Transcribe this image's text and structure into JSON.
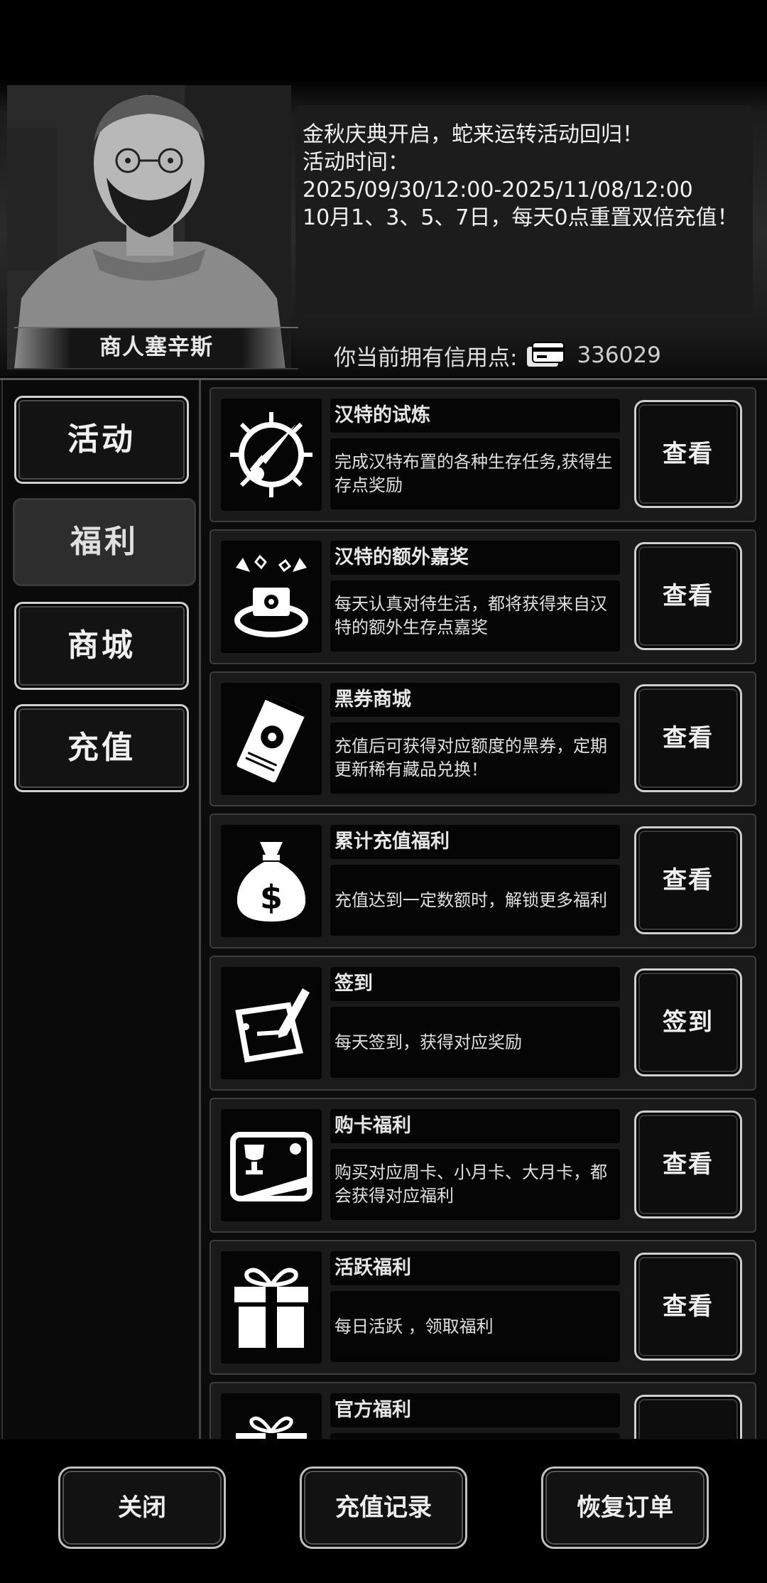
{
  "merchant": {
    "name": "商人塞辛斯"
  },
  "notice": {
    "line1": "金秋庆典开启，蛇来运转活动回归！",
    "line2": "活动时间：",
    "line3": "2025/09/30/12:00-2025/11/08/12:00",
    "line4": "10月1、3、5、7日，每天0点重置双倍充值！"
  },
  "credit": {
    "label": "你当前拥有信用点:",
    "icon": "credit-card-icon",
    "value": "336029"
  },
  "sidebar": {
    "items": [
      {
        "label": "活动",
        "active": false
      },
      {
        "label": "福利",
        "active": true
      },
      {
        "label": "商城",
        "active": false
      },
      {
        "label": "充值",
        "active": false
      }
    ]
  },
  "cards": [
    {
      "icon": "sword-sun-icon",
      "title": "汉特的试炼",
      "desc": "完成汉特布置的各种生存任务,获得生存点奖励",
      "button": "查看"
    },
    {
      "icon": "gift-burst-icon",
      "title": "汉特的额外嘉奖",
      "desc": "每天认真对待生活，都将获得来自汉特的额外生存点嘉奖",
      "button": "查看"
    },
    {
      "icon": "ticket-icon",
      "title": "黑券商城",
      "desc": "充值后可获得对应额度的黑券，定期更新稀有藏品兑换！",
      "button": "查看"
    },
    {
      "icon": "money-bag-icon",
      "title": "累计充值福利",
      "desc": "充值达到一定数额时，解锁更多福利",
      "button": "查看"
    },
    {
      "icon": "sign-pen-icon",
      "title": "签到",
      "desc": "每天签到，获得对应奖励",
      "button": "签到"
    },
    {
      "icon": "trophy-card-icon",
      "title": "购卡福利",
      "desc": "购买对应周卡、小月卡、大月卡，都会获得对应福利",
      "button": "查看"
    },
    {
      "icon": "gift-box-icon",
      "title": "活跃福利",
      "desc": "每日活跃 ，领取福利",
      "button": "查看"
    },
    {
      "icon": "gift-partial-icon",
      "title": "官方福利",
      "desc": "",
      "button": ""
    }
  ],
  "footer": {
    "close": "关闭",
    "history": "充值记录",
    "restore": "恢复订单"
  }
}
